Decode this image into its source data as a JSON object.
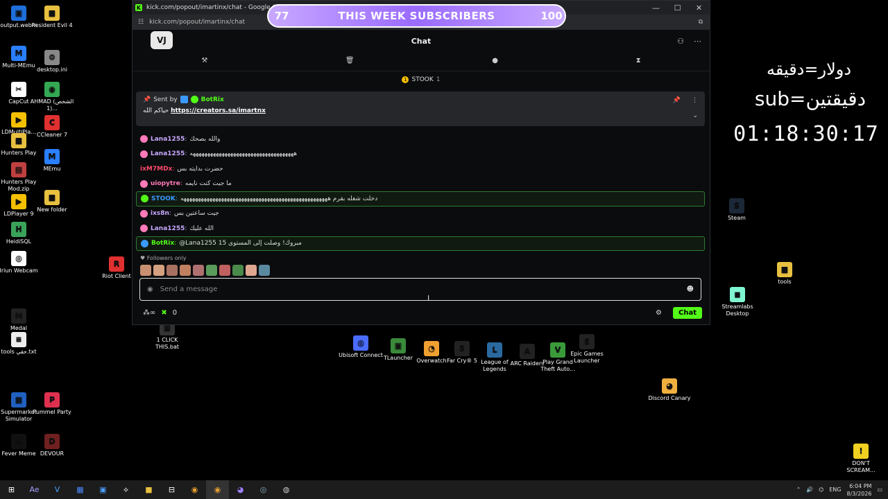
{
  "desktop_icons_left": [
    {
      "label": "output.webm",
      "color": "#1e6fd9",
      "glyph": "▣"
    },
    {
      "label": "Resident Evil 4",
      "color": "#e8c040",
      "glyph": "■"
    },
    {
      "label": "Multi-MEmu",
      "color": "#2a7fff",
      "glyph": "M"
    },
    {
      "label": "desktop.ini",
      "color": "#888888",
      "glyph": "⚙"
    },
    {
      "label": "CapCut",
      "color": "#ffffff",
      "glyph": "✂"
    },
    {
      "label": "AHMAD (الشخص 1)...",
      "color": "#34a853",
      "glyph": "◉"
    },
    {
      "label": "LDMultiPla...",
      "color": "#f5c000",
      "glyph": "▶"
    },
    {
      "label": "CCleaner 7",
      "color": "#e03030",
      "glyph": "C"
    },
    {
      "label": "Hunters Play",
      "color": "#e8c040",
      "glyph": "■"
    },
    {
      "label": "MEmu",
      "color": "#2a7fff",
      "glyph": "M"
    },
    {
      "label": "Hunters Play Mod.zip",
      "color": "#c04040",
      "glyph": "▤"
    },
    {
      "label": "LDPlayer 9",
      "color": "#f5c000",
      "glyph": "▶"
    },
    {
      "label": "New folder",
      "color": "#e8c040",
      "glyph": "■"
    },
    {
      "label": "HeidiSQL",
      "color": "#3aa35a",
      "glyph": "H"
    },
    {
      "label": "Iriun Webcam",
      "color": "#ffffff",
      "glyph": "◎"
    },
    {
      "label": "Riot Client",
      "color": "#e03030",
      "glyph": "R"
    },
    {
      "label": "Medal",
      "color": "#222222",
      "glyph": "M"
    },
    {
      "label": "1 CLICK THIS.bat",
      "color": "#333333",
      "glyph": "▣"
    },
    {
      "label": "tools حقي.txt",
      "color": "#eeeeee",
      "glyph": "≡"
    },
    {
      "label": "Supermarket Simulator",
      "color": "#2060c0",
      "glyph": "▦"
    },
    {
      "label": "Pummel Party",
      "color": "#e03050",
      "glyph": "P"
    },
    {
      "label": "Fever Meme",
      "color": "#111111",
      "glyph": "M"
    },
    {
      "label": "DEVOUR",
      "color": "#702020",
      "glyph": "D"
    }
  ],
  "desktop_icons_center": [
    {
      "label": "Ubisoft Connect",
      "color": "#4a6cff",
      "glyph": "◎"
    },
    {
      "label": "TLauncher",
      "color": "#3a8a3a",
      "glyph": "▣"
    },
    {
      "label": "Overwatch",
      "color": "#f0a030",
      "glyph": "◔"
    },
    {
      "label": "Far Cry® 5",
      "color": "#222222",
      "glyph": "5"
    },
    {
      "label": "League of Legends",
      "color": "#2a6aa0",
      "glyph": "L"
    },
    {
      "label": "ARC Raiders",
      "color": "#222222",
      "glyph": "A"
    },
    {
      "label": "Play Grand Theft Auto...",
      "color": "#3a9a3a",
      "glyph": "V"
    },
    {
      "label": "Epic Games Launcher",
      "color": "#222222",
      "glyph": "E"
    }
  ],
  "desktop_icons_right": [
    {
      "label": "Steam",
      "color": "#1b2838",
      "glyph": "S"
    },
    {
      "label": "tools",
      "color": "#e8c040",
      "glyph": "■"
    },
    {
      "label": "Streamlabs Desktop",
      "color": "#80f5d2",
      "glyph": "◼"
    },
    {
      "label": "Discord Canary",
      "color": "#f0b040",
      "glyph": "◕"
    },
    {
      "label": "DON'T SCREAM...",
      "color": "#f0d020",
      "glyph": "!"
    }
  ],
  "browser": {
    "title": "kick.com/popout/imartinx/chat - Google Chrome",
    "url": "kick.com/popout/imartinx/chat"
  },
  "chat": {
    "header_title": "Chat",
    "logo": "VJ",
    "pinned_top_user": "STOOK",
    "pinned_top_count": "1",
    "pinned": {
      "sent_by": "Sent by",
      "bot_name": "BotRix",
      "text_prefix": "حياكم الله",
      "link": "https://creators.sa/imartnx"
    },
    "messages": [
      {
        "user": "Lana1255",
        "text": "والله بصحك",
        "color": "#c8a8ff",
        "badge": "#ff7ab8",
        "hl": false
      },
      {
        "user": "Lana1255",
        "text": "ههههههههههههههههههههههههههههههههههههه",
        "color": "#c8a8ff",
        "badge": "#ff7ab8",
        "hl": false
      },
      {
        "user": "ixM7MDx",
        "text": "حضرت بدايته بس",
        "color": "#ff4a6a",
        "badge": "",
        "hl": false
      },
      {
        "user": "uiopytre",
        "text": "ما جيت كنت نايمه",
        "color": "#ff7ab8",
        "badge": "#ff7ab8",
        "hl": false
      },
      {
        "user": "STOOK",
        "text": "دخلت شغله بقرم هههههههههههههههههههههههههههههههههههههههههههههههههههه",
        "color": "#3a9aff",
        "badge": "#53fc18",
        "hl": true
      },
      {
        "user": "ixs8n",
        "text": "جيت ساعتين بس",
        "color": "#c8a8ff",
        "badge": "#ff7ab8",
        "hl": false
      },
      {
        "user": "Lana1255",
        "text": "الله عليك",
        "color": "#c8a8ff",
        "badge": "#ff7ab8",
        "hl": false
      },
      {
        "user": "BotRix",
        "text": "@Lana1255 مبروك! وصلت إلى المستوى 15",
        "color": "#53fc18",
        "badge": "#3a9aff",
        "hl": true
      }
    ],
    "followers_only": "Followers only",
    "input_placeholder": "Send a message",
    "viewer_count": "0",
    "chat_button": "Chat"
  },
  "overlay": {
    "left_count": "77",
    "title": "THIS WEEK SUBSCRIBERS",
    "right_count": "100"
  },
  "right_overlay": {
    "line1": "دولار=دقيقه",
    "line2": "sub=دقيقتين",
    "timer": "01:18:30:17"
  },
  "taskbar": {
    "lang": "ENG",
    "time": "6:04 PM",
    "date": "8/3/2026"
  }
}
